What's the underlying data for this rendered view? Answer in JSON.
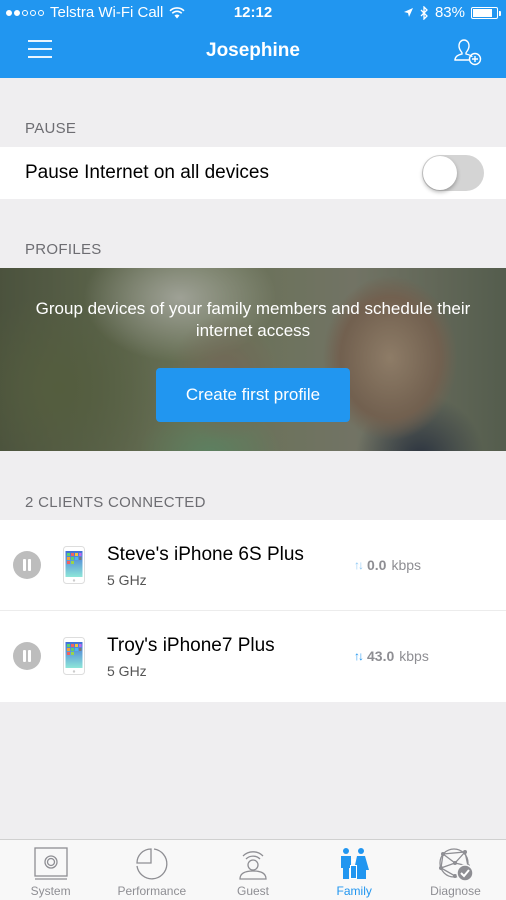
{
  "status_bar": {
    "carrier": "Telstra Wi-Fi Call",
    "signal_bars_filled": 2,
    "signal_bars_total": 5,
    "time": "12:12",
    "battery_percent": "83%",
    "battery_level": 0.83
  },
  "header": {
    "title": "Josephine",
    "menu_icon": "hamburger-menu-icon",
    "add_user_icon": "add-user-icon"
  },
  "pause_section": {
    "label": "PAUSE",
    "row_label": "Pause Internet on all devices",
    "toggle_on": false
  },
  "profiles_section": {
    "label": "PROFILES",
    "banner_text": "Group devices of your family members and schedule their internet access",
    "create_button": "Create first profile"
  },
  "clients_section": {
    "label": "2 CLIENTS CONNECTED",
    "clients": [
      {
        "name": "Steve's iPhone 6S Plus",
        "band": "5 GHz",
        "rate": "0.0",
        "unit": "kbps",
        "arrow_color": "#8ec9f5"
      },
      {
        "name": "Troy's iPhone7 Plus",
        "band": "5 GHz",
        "rate": "43.0",
        "unit": "kbps",
        "arrow_color": "#2196f0"
      }
    ]
  },
  "tabbar": {
    "tabs": [
      {
        "label": "System",
        "icon": "router-icon",
        "active": false
      },
      {
        "label": "Performance",
        "icon": "pie-chart-icon",
        "active": false
      },
      {
        "label": "Guest",
        "icon": "guest-wifi-icon",
        "active": false
      },
      {
        "label": "Family",
        "icon": "family-icon",
        "active": true
      },
      {
        "label": "Diagnose",
        "icon": "network-check-icon",
        "active": false
      }
    ]
  },
  "colors": {
    "accent": "#2196f0",
    "background": "#efeef0",
    "inactive_tab": "#8e8e93"
  }
}
